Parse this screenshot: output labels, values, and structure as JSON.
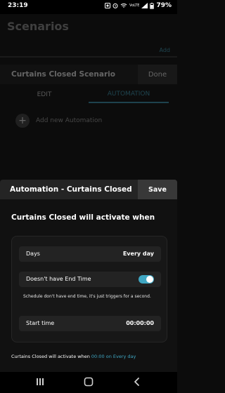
{
  "status_bar": {
    "time": "23:19",
    "battery_percent": "79%",
    "network_label": "VoLTE"
  },
  "background_screen": {
    "title": "Scenarios",
    "add_label": "Add",
    "scenario_title": "Curtains Closed Scenario",
    "done_label": "Done",
    "tabs": [
      {
        "label": "EDIT"
      },
      {
        "label": "AUTOMATION"
      }
    ],
    "add_automation_label": "Add new Automation"
  },
  "sheet": {
    "title": "Automation - Curtains Closed",
    "save_label": "Save",
    "activate_heading": "Curtains Closed will activate when",
    "days_label": "Days",
    "days_value": "Every day",
    "end_time_label": "Doesn't have End Time",
    "end_time_enabled": true,
    "note": "Schedule don't have end time, it's just triggers for a second.",
    "start_time_label": "Start time",
    "start_time_value": "00:00:00",
    "summary_prefix": "Curtains Closed will activate when ",
    "summary_highlight": "00:00 on Every day"
  },
  "colors": {
    "accent": "#3fa6c2",
    "background": "#0c0c0c",
    "sheet_header": "#242424"
  },
  "icons": {
    "status_left": [
      "photo-icon",
      "alarm-clock-icon"
    ],
    "status_right": [
      "wifi-icon",
      "signal-icon",
      "battery-icon"
    ],
    "nav": [
      "recents-icon",
      "home-icon",
      "back-icon"
    ]
  }
}
